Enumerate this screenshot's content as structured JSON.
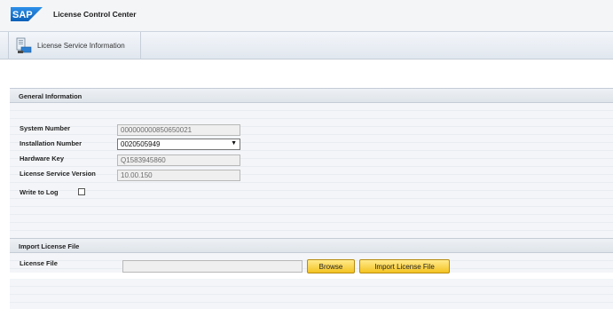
{
  "app": {
    "logo_text": "SAP",
    "title": "License Control Center"
  },
  "tabs": [
    {
      "label": "License Service Information",
      "icon": "license-service-icon"
    }
  ],
  "general_information": {
    "title": "General Information",
    "system_number": {
      "label": "System Number",
      "value": "000000000850650021"
    },
    "installation_number": {
      "label": "Installation Number",
      "selected": "0020505949"
    },
    "hardware_key": {
      "label": "Hardware Key",
      "value": "Q1583945860"
    },
    "license_service_version": {
      "label": "License Service Version",
      "value": "10.00.150"
    },
    "write_to_log": {
      "label": "Write to Log",
      "checked": false
    }
  },
  "import_license_file": {
    "title": "Import License File",
    "license_file": {
      "label": "License File",
      "value": ""
    },
    "browse_label": "Browse",
    "import_label": "Import License File"
  },
  "colors": {
    "sap_blue": "#1a6fc1",
    "button_yellow": "#f4c321"
  }
}
